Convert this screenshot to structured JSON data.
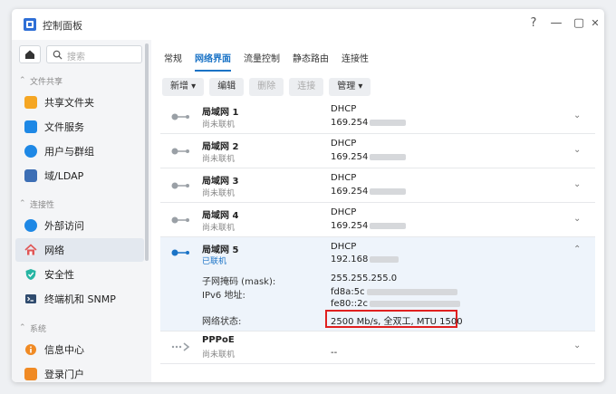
{
  "window": {
    "title": "控制面板",
    "help_glyph": "?",
    "minimize_glyph": "—",
    "maximize_glyph": "▢",
    "close_glyph": "✕"
  },
  "sidebar": {
    "search_placeholder": "搜索",
    "sections": [
      {
        "label": "文件共享",
        "items": [
          {
            "label": "共享文件夹",
            "icon": "folder-icon",
            "color": "#f5a623"
          },
          {
            "label": "文件服务",
            "icon": "file-services-icon",
            "color": "#1e88e5"
          },
          {
            "label": "用户与群组",
            "icon": "users-icon",
            "color": "#1e88e5"
          },
          {
            "label": "域/LDAP",
            "icon": "domain-icon",
            "color": "#3d6fb5"
          }
        ]
      },
      {
        "label": "连接性",
        "items": [
          {
            "label": "外部访问",
            "icon": "globe-icon",
            "color": "#1e88e5"
          },
          {
            "label": "网络",
            "icon": "house-network-icon",
            "color": "#e05656",
            "active": true
          },
          {
            "label": "安全性",
            "icon": "shield-icon",
            "color": "#26b5a3"
          },
          {
            "label": "终端机和 SNMP",
            "icon": "terminal-icon",
            "color": "#2f4b6e"
          }
        ]
      },
      {
        "label": "系统",
        "items": [
          {
            "label": "信息中心",
            "icon": "info-icon",
            "color": "#f08a24"
          },
          {
            "label": "登录门户",
            "icon": "login-portal-icon",
            "color": "#f08a24"
          }
        ]
      }
    ]
  },
  "tabs": [
    "常规",
    "网络界面",
    "流量控制",
    "静态路由",
    "连接性"
  ],
  "active_tab": "网络界面",
  "toolbar": {
    "new": "新增 ▾",
    "edit": "编辑",
    "delete": "删除",
    "connect": "连接",
    "manage": "管理 ▾"
  },
  "interfaces": [
    {
      "name": "局域网 1",
      "status": "尚未联机",
      "mode": "DHCP",
      "ip": "169.254"
    },
    {
      "name": "局域网 2",
      "status": "尚未联机",
      "mode": "DHCP",
      "ip": "169.254"
    },
    {
      "name": "局域网 3",
      "status": "尚未联机",
      "mode": "DHCP",
      "ip": "169.254"
    },
    {
      "name": "局域网 4",
      "status": "尚未联机",
      "mode": "DHCP",
      "ip": "169.254"
    },
    {
      "name": "局域网 5",
      "status": "已联机",
      "mode": "DHCP",
      "ip": "192.168",
      "details": {
        "mask_label": "子网掩码 (mask):",
        "mask_value": "255.255.255.0",
        "ipv6_label": "IPv6 地址:",
        "ipv6_1": "fd8a:5c",
        "ipv6_2": "fe80::2c",
        "net_status_label": "网络状态:",
        "net_status_value": "2500 Mb/s, 全双工, MTU 1500"
      }
    },
    {
      "name": "PPPoE",
      "status": "尚未联机",
      "mode": "--"
    }
  ],
  "colors": {
    "accent": "#1a73c6",
    "highlight_box": "#e02020",
    "connected_icon": "#1a73c6",
    "disconnected_icon": "#9aa0a6"
  }
}
